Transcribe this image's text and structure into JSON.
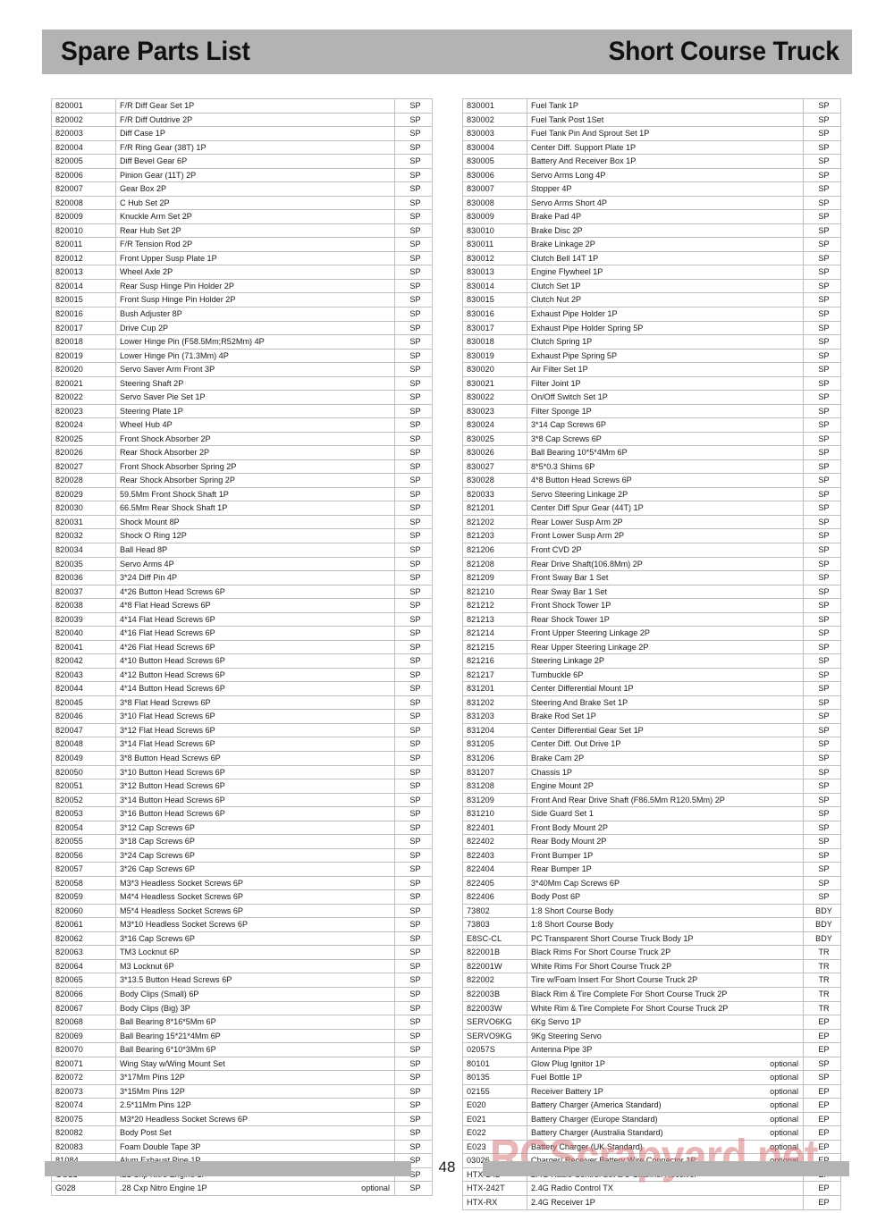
{
  "header": {
    "title_left": "Spare Parts List",
    "title_right": "Short Course Truck",
    "background_color": "#b3b3b3"
  },
  "footer": {
    "page_number": "48",
    "bar_color": "#b3b3b3"
  },
  "watermark": {
    "text": "RCScrapyard.net",
    "color": "#d67a7a"
  },
  "table": {
    "optional_label": "optional",
    "type_sp": "SP",
    "type_bdy": "BDY",
    "type_tr": "TR",
    "type_ep": "EP"
  },
  "left_column": [
    {
      "code": "820001",
      "desc": "F/R Diff Gear Set 1P",
      "opt": "",
      "type": "SP"
    },
    {
      "code": "820002",
      "desc": "F/R Diff Outdrive 2P",
      "opt": "",
      "type": "SP"
    },
    {
      "code": "820003",
      "desc": "Diff Case 1P",
      "opt": "",
      "type": "SP"
    },
    {
      "code": "820004",
      "desc": "F/R Ring Gear (38T) 1P",
      "opt": "",
      "type": "SP"
    },
    {
      "code": "820005",
      "desc": "Diff Bevel Gear 6P",
      "opt": "",
      "type": "SP"
    },
    {
      "code": "820006",
      "desc": "Pinion Gear (11T) 2P",
      "opt": "",
      "type": "SP"
    },
    {
      "code": "820007",
      "desc": "Gear Box 2P",
      "opt": "",
      "type": "SP"
    },
    {
      "code": "820008",
      "desc": "C Hub Set 2P",
      "opt": "",
      "type": "SP"
    },
    {
      "code": "820009",
      "desc": "Knuckle Arm Set 2P",
      "opt": "",
      "type": "SP"
    },
    {
      "code": "820010",
      "desc": "Rear Hub Set 2P",
      "opt": "",
      "type": "SP"
    },
    {
      "code": "820011",
      "desc": "F/R Tension Rod 2P",
      "opt": "",
      "type": "SP"
    },
    {
      "code": "820012",
      "desc": "Front Upper Susp Plate 1P",
      "opt": "",
      "type": "SP"
    },
    {
      "code": "820013",
      "desc": "Wheel Axle 2P",
      "opt": "",
      "type": "SP"
    },
    {
      "code": "820014",
      "desc": "Rear Susp Hinge Pin Holder 2P",
      "opt": "",
      "type": "SP"
    },
    {
      "code": "820015",
      "desc": "Front Susp Hinge Pin Holder 2P",
      "opt": "",
      "type": "SP"
    },
    {
      "code": "820016",
      "desc": "Bush Adjuster 8P",
      "opt": "",
      "type": "SP"
    },
    {
      "code": "820017",
      "desc": "Drive Cup 2P",
      "opt": "",
      "type": "SP"
    },
    {
      "code": "820018",
      "desc": "Lower Hinge Pin (F58.5Mm;R52Mm) 4P",
      "opt": "",
      "type": "SP"
    },
    {
      "code": "820019",
      "desc": "Lower Hinge Pin (71.3Mm) 4P",
      "opt": "",
      "type": "SP"
    },
    {
      "code": "820020",
      "desc": "Servo Saver Arm Front 3P",
      "opt": "",
      "type": "SP"
    },
    {
      "code": "820021",
      "desc": "Steering Shaft 2P",
      "opt": "",
      "type": "SP"
    },
    {
      "code": "820022",
      "desc": "Servo Saver Pie Set 1P",
      "opt": "",
      "type": "SP"
    },
    {
      "code": "820023",
      "desc": "Steering Plate 1P",
      "opt": "",
      "type": "SP"
    },
    {
      "code": "820024",
      "desc": "Wheel Hub 4P",
      "opt": "",
      "type": "SP"
    },
    {
      "code": "820025",
      "desc": "Front Shock Absorber 2P",
      "opt": "",
      "type": "SP"
    },
    {
      "code": "820026",
      "desc": "Rear Shock Absorber 2P",
      "opt": "",
      "type": "SP"
    },
    {
      "code": "820027",
      "desc": "Front Shock Absorber Spring 2P",
      "opt": "",
      "type": "SP"
    },
    {
      "code": "820028",
      "desc": "Rear Shock Absorber Spring 2P",
      "opt": "",
      "type": "SP"
    },
    {
      "code": "820029",
      "desc": "59.5Mm Front Shock Shaft 1P",
      "opt": "",
      "type": "SP"
    },
    {
      "code": "820030",
      "desc": "66.5Mm Rear Shock Shaft 1P",
      "opt": "",
      "type": "SP"
    },
    {
      "code": "820031",
      "desc": "Shock Mount 8P",
      "opt": "",
      "type": "SP"
    },
    {
      "code": "820032",
      "desc": "Shock O Ring 12P",
      "opt": "",
      "type": "SP"
    },
    {
      "code": "820034",
      "desc": "Ball Head 8P",
      "opt": "",
      "type": "SP"
    },
    {
      "code": "820035",
      "desc": "Servo Arms 4P",
      "opt": "",
      "type": "SP"
    },
    {
      "code": "820036",
      "desc": "3*24 Diff Pin 4P",
      "opt": "",
      "type": "SP"
    },
    {
      "code": "820037",
      "desc": "4*26 Button Head Screws 6P",
      "opt": "",
      "type": "SP"
    },
    {
      "code": "820038",
      "desc": "4*8 Flat Head Screws 6P",
      "opt": "",
      "type": "SP"
    },
    {
      "code": "820039",
      "desc": "4*14 Flat Head Screws 6P",
      "opt": "",
      "type": "SP"
    },
    {
      "code": "820040",
      "desc": "4*16 Flat Head Screws 6P",
      "opt": "",
      "type": "SP"
    },
    {
      "code": "820041",
      "desc": "4*26 Flat Head Screws 6P",
      "opt": "",
      "type": "SP"
    },
    {
      "code": "820042",
      "desc": "4*10 Button Head Screws 6P",
      "opt": "",
      "type": "SP"
    },
    {
      "code": "820043",
      "desc": "4*12 Button Head Screws 6P",
      "opt": "",
      "type": "SP"
    },
    {
      "code": "820044",
      "desc": "4*14 Button Head Screws 6P",
      "opt": "",
      "type": "SP"
    },
    {
      "code": "820045",
      "desc": "3*8 Flat Head Screws 6P",
      "opt": "",
      "type": "SP"
    },
    {
      "code": "820046",
      "desc": "3*10 Flat Head Screws 6P",
      "opt": "",
      "type": "SP"
    },
    {
      "code": "820047",
      "desc": "3*12 Flat Head Screws 6P",
      "opt": "",
      "type": "SP"
    },
    {
      "code": "820048",
      "desc": "3*14 Flat Head Screws 6P",
      "opt": "",
      "type": "SP"
    },
    {
      "code": "820049",
      "desc": "3*8 Button Head Screws 6P",
      "opt": "",
      "type": "SP"
    },
    {
      "code": "820050",
      "desc": "3*10 Button Head Screws 6P",
      "opt": "",
      "type": "SP"
    },
    {
      "code": "820051",
      "desc": "3*12 Button Head Screws 6P",
      "opt": "",
      "type": "SP"
    },
    {
      "code": "820052",
      "desc": "3*14 Button Head Screws 6P",
      "opt": "",
      "type": "SP"
    },
    {
      "code": "820053",
      "desc": "3*16 Button Head Screws 6P",
      "opt": "",
      "type": "SP"
    },
    {
      "code": "820054",
      "desc": "3*12 Cap Screws 6P",
      "opt": "",
      "type": "SP"
    },
    {
      "code": "820055",
      "desc": "3*18 Cap Screws 6P",
      "opt": "",
      "type": "SP"
    },
    {
      "code": "820056",
      "desc": "3*24 Cap Screws 6P",
      "opt": "",
      "type": "SP"
    },
    {
      "code": "820057",
      "desc": "3*26 Cap Screws 6P",
      "opt": "",
      "type": "SP"
    },
    {
      "code": "820058",
      "desc": "M3*3 Headless Socket Screws 6P",
      "opt": "",
      "type": "SP"
    },
    {
      "code": "820059",
      "desc": "M4*4 Headless Socket Screws 6P",
      "opt": "",
      "type": "SP"
    },
    {
      "code": "820060",
      "desc": "M5*4 Headless Socket Screws 6P",
      "opt": "",
      "type": "SP"
    },
    {
      "code": "820061",
      "desc": "M3*10 Headless Socket Screws 6P",
      "opt": "",
      "type": "SP"
    },
    {
      "code": "820062",
      "desc": "3*16 Cap Screws 6P",
      "opt": "",
      "type": "SP"
    },
    {
      "code": "820063",
      "desc": "TM3 Locknut 6P",
      "opt": "",
      "type": "SP"
    },
    {
      "code": "820064",
      "desc": "M3 Locknut 6P",
      "opt": "",
      "type": "SP"
    },
    {
      "code": "820065",
      "desc": "3*13.5 Button Head Screws 6P",
      "opt": "",
      "type": "SP"
    },
    {
      "code": "820066",
      "desc": "Body Clips (Small) 6P",
      "opt": "",
      "type": "SP"
    },
    {
      "code": "820067",
      "desc": "Body Clips (Big) 3P",
      "opt": "",
      "type": "SP"
    },
    {
      "code": "820068",
      "desc": "Ball Bearing 8*16*5Mm 6P",
      "opt": "",
      "type": "SP"
    },
    {
      "code": "820069",
      "desc": "Ball Bearing 15*21*4Mm 6P",
      "opt": "",
      "type": "SP"
    },
    {
      "code": "820070",
      "desc": "Ball Bearing 6*10*3Mm 6P",
      "opt": "",
      "type": "SP"
    },
    {
      "code": "820071",
      "desc": "Wing Stay w/Wing Mount  Set",
      "opt": "",
      "type": "SP"
    },
    {
      "code": "820072",
      "desc": "3*17Mm Pins 12P",
      "opt": "",
      "type": "SP"
    },
    {
      "code": "820073",
      "desc": "3*15Mm Pins 12P",
      "opt": "",
      "type": "SP"
    },
    {
      "code": "820074",
      "desc": "2.5*11Mm Pins 12P",
      "opt": "",
      "type": "SP"
    },
    {
      "code": "820075",
      "desc": "M3*20 Headless Socket Screws 6P",
      "opt": "",
      "type": "SP"
    },
    {
      "code": "820082",
      "desc": "Body Post  Set",
      "opt": "",
      "type": "SP"
    },
    {
      "code": "820083",
      "desc": "Foam Double Tape 3P",
      "opt": "",
      "type": "SP"
    },
    {
      "code": "81084",
      "desc": "Alum Exhaust Pipe 1P",
      "opt": "",
      "type": "SP"
    },
    {
      "code": "GO21",
      "desc": ".21 Cxp Nitro Engine 1P",
      "opt": "",
      "type": "SP"
    },
    {
      "code": "G028",
      "desc": ".28 Cxp Nitro Engine 1P",
      "opt": "optional",
      "type": "SP"
    }
  ],
  "right_column": [
    {
      "code": "830001",
      "desc": "Fuel Tank 1P",
      "opt": "",
      "type": "SP"
    },
    {
      "code": "830002",
      "desc": "Fuel Tank Post 1Set",
      "opt": "",
      "type": "SP"
    },
    {
      "code": "830003",
      "desc": "Fuel Tank Pin And Sprout Set 1P",
      "opt": "",
      "type": "SP"
    },
    {
      "code": "830004",
      "desc": "Center Diff. Support Plate 1P",
      "opt": "",
      "type": "SP"
    },
    {
      "code": "830005",
      "desc": "Battery And Receiver Box 1P",
      "opt": "",
      "type": "SP"
    },
    {
      "code": "830006",
      "desc": "Servo Arms Long 4P",
      "opt": "",
      "type": "SP"
    },
    {
      "code": "830007",
      "desc": "Stopper 4P",
      "opt": "",
      "type": "SP"
    },
    {
      "code": "830008",
      "desc": "Servo Arms Short 4P",
      "opt": "",
      "type": "SP"
    },
    {
      "code": "830009",
      "desc": "Brake Pad 4P",
      "opt": "",
      "type": "SP"
    },
    {
      "code": "830010",
      "desc": "Brake Disc 2P",
      "opt": "",
      "type": "SP"
    },
    {
      "code": "830011",
      "desc": "Brake Linkage 2P",
      "opt": "",
      "type": "SP"
    },
    {
      "code": "830012",
      "desc": "Clutch Bell 14T 1P",
      "opt": "",
      "type": "SP"
    },
    {
      "code": "830013",
      "desc": "Engine Flywheel 1P",
      "opt": "",
      "type": "SP"
    },
    {
      "code": "830014",
      "desc": "Clutch Set 1P",
      "opt": "",
      "type": "SP"
    },
    {
      "code": "830015",
      "desc": "Clutch Nut 2P",
      "opt": "",
      "type": "SP"
    },
    {
      "code": "830016",
      "desc": "Exhaust Pipe Holder 1P",
      "opt": "",
      "type": "SP"
    },
    {
      "code": "830017",
      "desc": "Exhaust Pipe Holder Spring 5P",
      "opt": "",
      "type": "SP"
    },
    {
      "code": "830018",
      "desc": "Clutch Spring 1P",
      "opt": "",
      "type": "SP"
    },
    {
      "code": "830019",
      "desc": "Exhaust Pipe Spring 5P",
      "opt": "",
      "type": "SP"
    },
    {
      "code": "830020",
      "desc": "Air Filter Set 1P",
      "opt": "",
      "type": "SP"
    },
    {
      "code": "830021",
      "desc": "Filter Joint 1P",
      "opt": "",
      "type": "SP"
    },
    {
      "code": "830022",
      "desc": "On/Off Switch Set 1P",
      "opt": "",
      "type": "SP"
    },
    {
      "code": "830023",
      "desc": "Filter Sponge 1P",
      "opt": "",
      "type": "SP"
    },
    {
      "code": "830024",
      "desc": "3*14 Cap Screws 6P",
      "opt": "",
      "type": "SP"
    },
    {
      "code": "830025",
      "desc": "3*8 Cap Screws 6P",
      "opt": "",
      "type": "SP"
    },
    {
      "code": "830026",
      "desc": "Ball Bearing 10*5*4Mm 6P",
      "opt": "",
      "type": "SP"
    },
    {
      "code": "830027",
      "desc": "8*5*0.3 Shims 6P",
      "opt": "",
      "type": "SP"
    },
    {
      "code": "830028",
      "desc": "4*8 Button Head Screws 6P",
      "opt": "",
      "type": "SP"
    },
    {
      "code": "820033",
      "desc": "Servo Steering Linkage 2P",
      "opt": "",
      "type": "SP"
    },
    {
      "code": "821201",
      "desc": "Center Diff Spur Gear (44T) 1P",
      "opt": "",
      "type": "SP"
    },
    {
      "code": "821202",
      "desc": "Rear Lower Susp Arm 2P",
      "opt": "",
      "type": "SP"
    },
    {
      "code": "821203",
      "desc": "Front Lower Susp Arm 2P",
      "opt": "",
      "type": "SP"
    },
    {
      "code": "821206",
      "desc": "Front CVD 2P",
      "opt": "",
      "type": "SP"
    },
    {
      "code": "821208",
      "desc": "Rear Drive Shaft(106.8Mm) 2P",
      "opt": "",
      "type": "SP"
    },
    {
      "code": "821209",
      "desc": "Front Sway Bar 1 Set",
      "opt": "",
      "type": "SP"
    },
    {
      "code": "821210",
      "desc": "Rear Sway Bar 1 Set",
      "opt": "",
      "type": "SP"
    },
    {
      "code": "821212",
      "desc": "Front Shock Tower 1P",
      "opt": "",
      "type": "SP"
    },
    {
      "code": "821213",
      "desc": "Rear Shock Tower 1P",
      "opt": "",
      "type": "SP"
    },
    {
      "code": "821214",
      "desc": "Front Upper Steering Linkage 2P",
      "opt": "",
      "type": "SP"
    },
    {
      "code": "821215",
      "desc": "Rear Upper Steering Linkage 2P",
      "opt": "",
      "type": "SP"
    },
    {
      "code": "821216",
      "desc": "Steering Linkage 2P",
      "opt": "",
      "type": "SP"
    },
    {
      "code": "821217",
      "desc": "Turnbuckle 6P",
      "opt": "",
      "type": "SP"
    },
    {
      "code": "831201",
      "desc": "Center Differential Mount 1P",
      "opt": "",
      "type": "SP"
    },
    {
      "code": "831202",
      "desc": "Steering And Brake Set 1P",
      "opt": "",
      "type": "SP"
    },
    {
      "code": "831203",
      "desc": "Brake Rod Set 1P",
      "opt": "",
      "type": "SP"
    },
    {
      "code": "831204",
      "desc": "Center Differential Gear Set 1P",
      "opt": "",
      "type": "SP"
    },
    {
      "code": "831205",
      "desc": "Center Diff. Out Drive 1P",
      "opt": "",
      "type": "SP"
    },
    {
      "code": "831206",
      "desc": "Brake Cam 2P",
      "opt": "",
      "type": "SP"
    },
    {
      "code": "831207",
      "desc": "Chassis 1P",
      "opt": "",
      "type": "SP"
    },
    {
      "code": "831208",
      "desc": "Engine Mount 2P",
      "opt": "",
      "type": "SP"
    },
    {
      "code": "831209",
      "desc": "Front And Rear Drive Shaft (F86.5Mm R120.5Mm) 2P",
      "opt": "",
      "type": "SP"
    },
    {
      "code": "831210",
      "desc": "Side Guard Set 1",
      "opt": "",
      "type": "SP"
    },
    {
      "code": "822401",
      "desc": "Front Body Mount  2P",
      "opt": "",
      "type": "SP"
    },
    {
      "code": "822402",
      "desc": "Rear Body Mount  2P",
      "opt": "",
      "type": "SP"
    },
    {
      "code": "822403",
      "desc": "Front Bumper  1P",
      "opt": "",
      "type": "SP"
    },
    {
      "code": "822404",
      "desc": "Rear Bumper  1P",
      "opt": "",
      "type": "SP"
    },
    {
      "code": "822405",
      "desc": "3*40Mm Cap Screws 6P",
      "opt": "",
      "type": "SP"
    },
    {
      "code": "822406",
      "desc": "Body Post 6P",
      "opt": "",
      "type": "SP"
    },
    {
      "code": "73802",
      "desc": "1:8 Short Course Body",
      "opt": "",
      "type": "BDY"
    },
    {
      "code": "73803",
      "desc": "1:8 Short Course Body",
      "opt": "",
      "type": "BDY"
    },
    {
      "code": "E8SC-CL",
      "desc": "PC Transparent Short Course Truck Body 1P",
      "opt": "",
      "type": "BDY"
    },
    {
      "code": "822001B",
      "desc": "Black Rims For Short Course Truck  2P",
      "opt": "",
      "type": "TR"
    },
    {
      "code": "822001W",
      "desc": "White Rims For Short Course Truck  2P",
      "opt": "",
      "type": "TR"
    },
    {
      "code": "822002",
      "desc": "Tire w/Foam Insert For Short Course Truck 2P",
      "opt": "",
      "type": "TR"
    },
    {
      "code": "822003B",
      "desc": "Black Rim & Tire Complete For Short Course Truck  2P",
      "opt": "",
      "type": "TR"
    },
    {
      "code": "822003W",
      "desc": "White Rim & Tire Complete For Short Course Truck  2P",
      "opt": "",
      "type": "TR"
    },
    {
      "code": "SERVO6KG",
      "desc": "6Kg Servo 1P",
      "opt": "",
      "type": "EP"
    },
    {
      "code": "SERVO9KG",
      "desc": "9Kg Steering Servo",
      "opt": "",
      "type": "EP"
    },
    {
      "code": "02057S",
      "desc": "Antenna Pipe 3P",
      "opt": "",
      "type": "EP"
    },
    {
      "code": "80101",
      "desc": "Glow Plug Ignitor 1P",
      "opt": "optional",
      "type": "SP"
    },
    {
      "code": "80135",
      "desc": "Fuel Bottle 1P",
      "opt": "optional",
      "type": "SP"
    },
    {
      "code": "02155",
      "desc": "Receiver Battery 1P",
      "opt": "optional",
      "type": "EP"
    },
    {
      "code": "E020",
      "desc": "Battery Charger (America Standard)",
      "opt": "optional",
      "type": "EP"
    },
    {
      "code": "E021",
      "desc": "Battery Charger (Europe Standard)",
      "opt": "optional",
      "type": "EP"
    },
    {
      "code": "E022",
      "desc": "Battery Charger (Australia Standard)",
      "opt": "optional",
      "type": "EP"
    },
    {
      "code": "E023",
      "desc": "Battery Charger (UK Standard)",
      "opt": "optional",
      "type": "EP"
    },
    {
      "code": "03026",
      "desc": "Charger/ Receiver Battery Wire Connector 1P",
      "opt": "optional",
      "type": "EP"
    },
    {
      "code": "HTX-242",
      "desc": "2.4G Radio Control Set & 3-Channel Receiver",
      "opt": "",
      "type": "EP"
    },
    {
      "code": "HTX-242T",
      "desc": "2.4G Radio Control TX",
      "opt": "",
      "type": "EP"
    },
    {
      "code": "HTX-RX",
      "desc": "2.4G Receiver 1P",
      "opt": "",
      "type": "EP"
    }
  ]
}
